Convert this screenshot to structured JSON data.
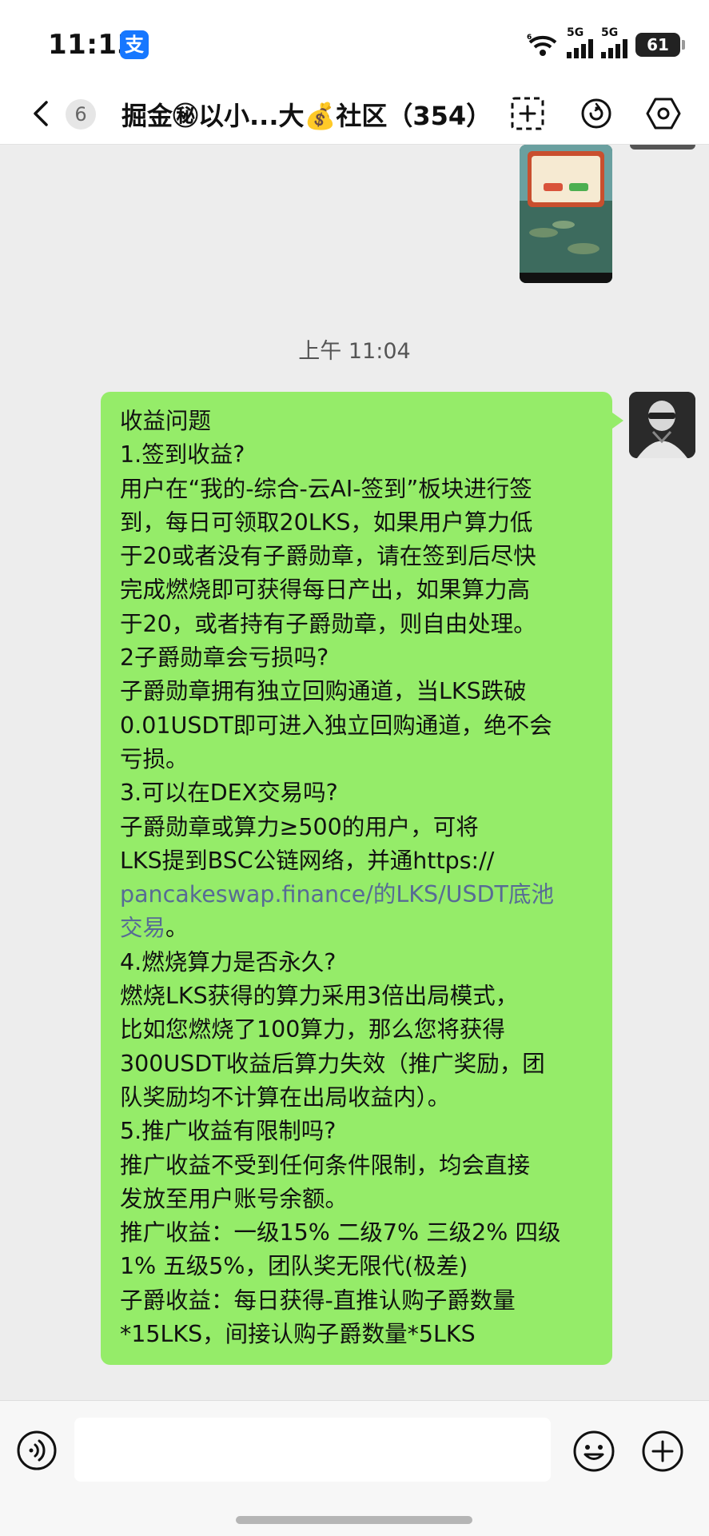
{
  "status_bar": {
    "time": "11:13",
    "alipay_icon": "支",
    "network_1": "5G",
    "network_2": "5G",
    "wifi_badge": "6",
    "battery": "61"
  },
  "header": {
    "unread_count": "6",
    "title": "掘金㊙以小...大💰社区（354）",
    "icons": [
      "back-chevron-icon",
      "scan-icon",
      "refresh-icon",
      "settings-icon"
    ]
  },
  "chat": {
    "timestamp": "上午 11:04",
    "message_lines": [
      "收益问题",
      "1.签到收益?",
      "用户在“我的-综合-云AI-签到”板块进行签",
      "到，每日可领取20LKS，如果用户算力低",
      "于20或者没有子爵勋章，请在签到后尽快",
      "完成燃烧即可获得每日产出，如果算力高",
      "于20，或者持有子爵勋章，则自由处理。",
      "2子爵勋章会亏损吗?",
      "子爵勋章拥有独立回购通道，当LKS跌破",
      "0.01USDT即可进入独立回购通道，绝不会",
      "亏损。",
      "3.可以在DEX交易吗?",
      "子爵勋章或算力≥500的用户，可将",
      "LKS提到BSC公链网络，并通https://"
    ],
    "link_line_1": "pancakeswap.finance/的LKS/USDT底池",
    "link_line_2": "交易",
    "link_line_2_tail": "。",
    "message_lines_after": [
      "4.燃烧算力是否永久?",
      "燃烧LKS获得的算力采用3倍出局模式，",
      "比如您燃烧了100算力，那么您将获得",
      "300USDT收益后算力失效（推广奖励，团",
      "队奖励均不计算在出局收益内）。",
      "5.推广收益有限制吗?",
      "推广收益不受到任何条件限制，均会直接",
      "发放至用户账号余额。",
      "推广收益：一级15% 二级7% 三级2% 四级",
      "1% 五级5%，团队奖无限代(极差)",
      "子爵收益：每日获得-直推认购子爵数量",
      "*15LKS，间接认购子爵数量*5LKS"
    ]
  },
  "colors": {
    "bubble": "#95ec69",
    "link": "#576b95",
    "background": "#ededed"
  }
}
